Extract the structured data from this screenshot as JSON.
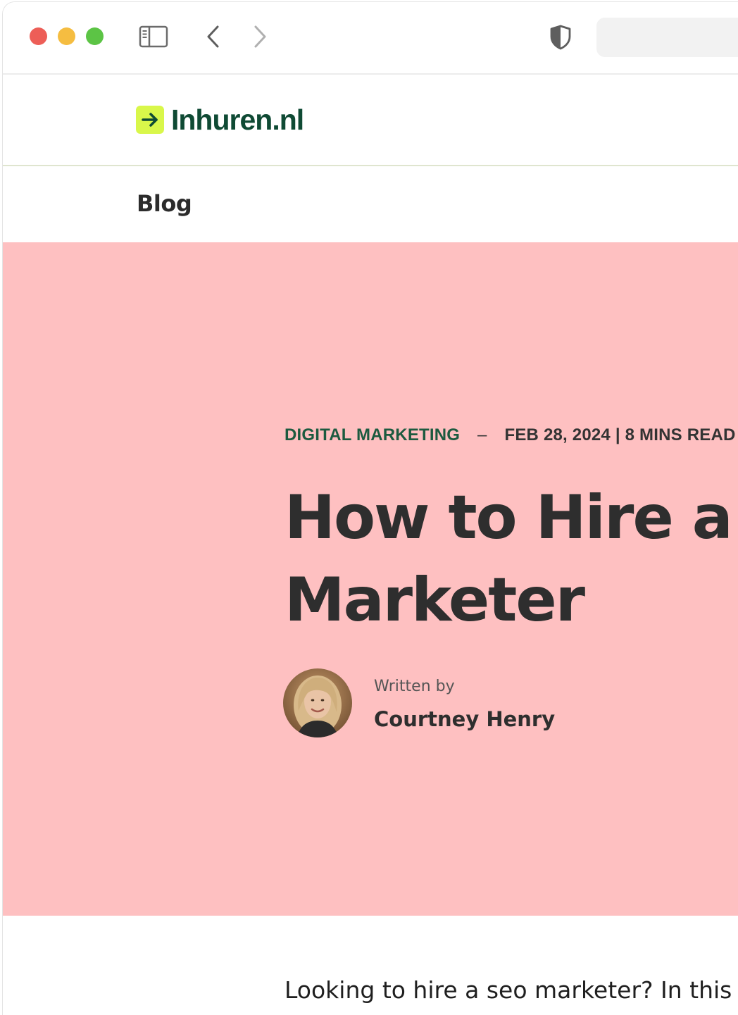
{
  "colors": {
    "traffic_red": "#ed5e57",
    "traffic_yellow": "#f5bd41",
    "traffic_green": "#5cc445",
    "brand_dark_green": "#0f4a34",
    "brand_lime": "#d9f74a",
    "hero_background": "#fec0c1",
    "category_green": "#1c5a3f"
  },
  "toolbar": {
    "sidebar_icon": "sidebar-icon",
    "back_icon": "chevron-left-icon",
    "forward_icon": "chevron-right-icon",
    "privacy_icon": "shield-icon",
    "address_value": ""
  },
  "header": {
    "logo_icon": "arrow-right-icon",
    "logo_text": "Inhuren.nl"
  },
  "subnav": {
    "blog_label": "Blog"
  },
  "hero": {
    "category": "DIGITAL MARKETING",
    "separator": "–",
    "date_readtime": "FEB 28, 2024 | 8 MINS READ",
    "title_line1": "How to Hire a Seo",
    "title_line2": "Marketer",
    "author_label": "Written by",
    "author_name": "Courtney Henry",
    "avatar_icon": "author-avatar"
  },
  "article": {
    "intro": "Looking to hire a seo marketer? In this"
  }
}
